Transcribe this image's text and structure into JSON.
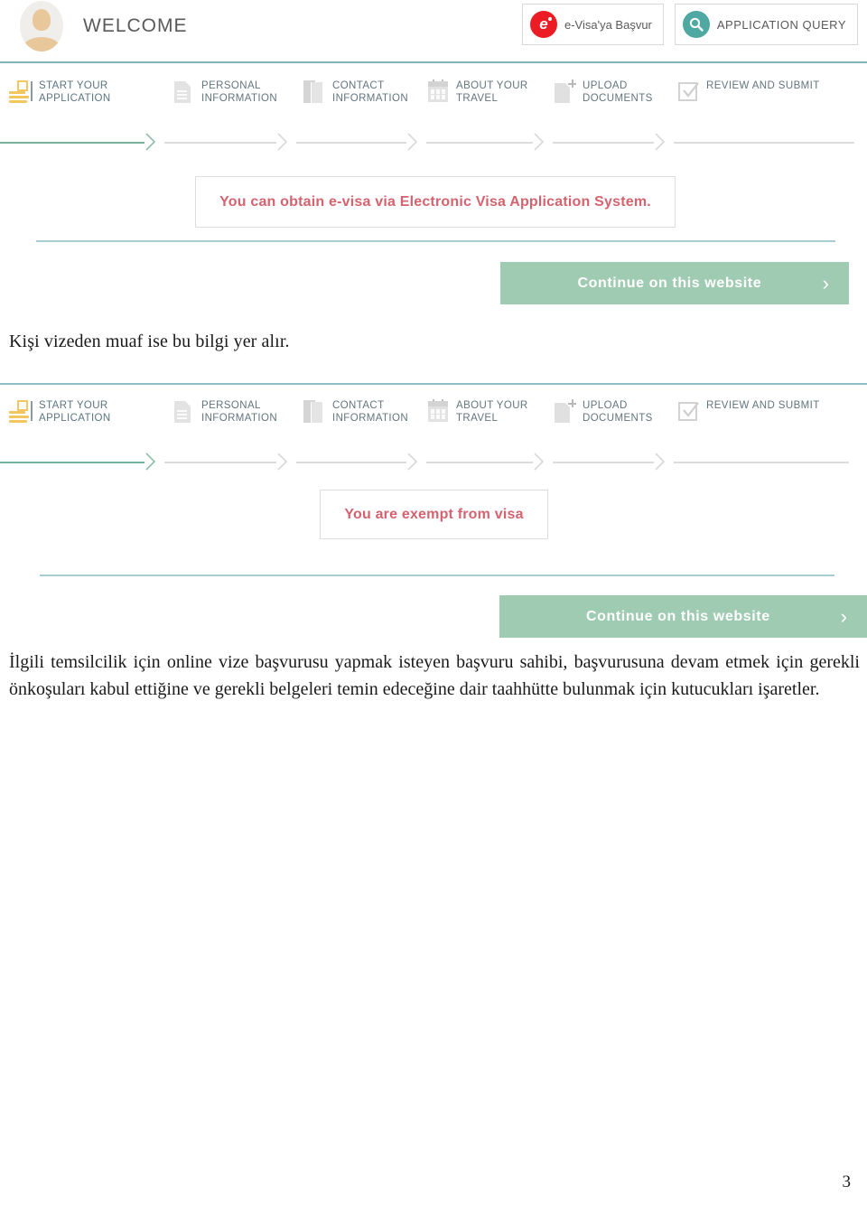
{
  "document": {
    "page_number": "3"
  },
  "screenshot_one": {
    "header": {
      "avatar_label": "user-avatar",
      "title": "WELCOME",
      "actions": [
        {
          "label": "e-Visa'ya Başvur",
          "icon": "evisa-logo-icon"
        },
        {
          "label": "APPLICATION QUERY",
          "icon": "search-circle-icon"
        }
      ]
    },
    "steps": [
      {
        "label": "START YOUR\nAPPLICATION",
        "icon": "document-lines-icon",
        "state": "active"
      },
      {
        "label": "PERSONAL\nINFORMATION",
        "icon": "page-icon",
        "state": "todo"
      },
      {
        "label": "CONTACT\nINFORMATION",
        "icon": "cards-icon",
        "state": "todo"
      },
      {
        "label": "ABOUT YOUR\nTRAVEL",
        "icon": "calendar-icon",
        "state": "todo"
      },
      {
        "label": "UPLOAD\nDOCUMENTS",
        "icon": "document-plus-icon",
        "state": "todo"
      },
      {
        "label": "REVIEW AND SUBMIT",
        "icon": "checkbox-checked-icon",
        "state": "todo"
      }
    ],
    "notice": "You can obtain e-visa via Electronic Visa Application System.",
    "continue_button": {
      "label": "Continue on this website",
      "chevron": "›"
    }
  },
  "caption_one": "Kişi vizeden muaf ise bu bilgi yer alır.",
  "screenshot_two": {
    "steps": [
      {
        "label": "START YOUR\nAPPLICATION",
        "icon": "document-lines-icon",
        "state": "active"
      },
      {
        "label": "PERSONAL\nINFORMATION",
        "icon": "page-icon",
        "state": "todo"
      },
      {
        "label": "CONTACT\nINFORMATION",
        "icon": "cards-icon",
        "state": "todo"
      },
      {
        "label": "ABOUT YOUR\nTRAVEL",
        "icon": "calendar-icon",
        "state": "todo"
      },
      {
        "label": "UPLOAD\nDOCUMENTS",
        "icon": "document-plus-icon",
        "state": "todo"
      },
      {
        "label": "REVIEW AND SUBMIT",
        "icon": "checkbox-checked-icon",
        "state": "todo"
      }
    ],
    "notice": "You are exempt from visa",
    "continue_button": {
      "label": "Continue on this website",
      "chevron": "›"
    }
  },
  "body_paragraph": "İlgili temsilcilik için online vize başvurusu yapmak isteyen başvuru sahibi, başvurusuna devam etmek için gerekli önkoşuları kabul ettiğine ve gerekli belgeleri temin edeceğine dair taahhütte bulunmak için kutucukları işaretler.",
  "colors": {
    "accent_teal": "#7eb5bd",
    "rule_teal": "#a8cdd1",
    "continue_green": "#a0cbb3",
    "notice_red": "#d4636f",
    "active_step_yellow": "#f2c760",
    "evisa_red": "#ec1c24",
    "query_teal": "#4fa8a2",
    "step_label_gray": "#63757d"
  }
}
